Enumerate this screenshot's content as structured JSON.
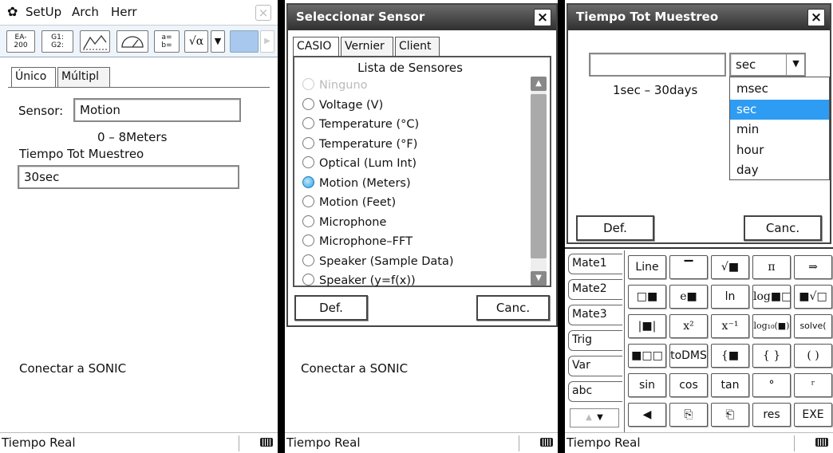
{
  "screen1": {
    "menu": {
      "setup": "SetUp",
      "arch": "Arch",
      "herr": "Herr"
    },
    "toolbar": {
      "b1a": "EA-",
      "b1b": "200",
      "b2a": "G1:",
      "b2b": "G2:",
      "b5a": "a=",
      "b5b": "b=",
      "b6": "√α",
      "b7": "▼"
    },
    "tabs": {
      "unico": "Único",
      "multiple": "Múltipl"
    },
    "sensor_label": "Sensor:",
    "sensor_value": "Motion",
    "range": "0 – 8Meters",
    "total_time_label": "Tiempo Tot Muestreo",
    "total_time_value": "30sec",
    "connect": "Conectar a SONIC",
    "status": "Tiempo Real"
  },
  "screen2": {
    "title": "Seleccionar Sensor",
    "tabs": {
      "casio": "CASIO",
      "vernier": "Vernier",
      "client": "Client"
    },
    "list_title": "Lista de Sensores",
    "options": [
      {
        "label": "Ninguno",
        "state": "disabled"
      },
      {
        "label": "Voltage (V)",
        "state": "off"
      },
      {
        "label": "Temperature (°C)",
        "state": "off"
      },
      {
        "label": "Temperature (°F)",
        "state": "off"
      },
      {
        "label": "Optical (Lum Int)",
        "state": "off"
      },
      {
        "label": "Motion (Meters)",
        "state": "on"
      },
      {
        "label": "Motion (Feet)",
        "state": "off"
      },
      {
        "label": "Microphone",
        "state": "off"
      },
      {
        "label": "Microphone–FFT",
        "state": "off"
      },
      {
        "label": "Speaker (Sample Data)",
        "state": "off"
      },
      {
        "label": "Speaker (y=f(x))",
        "state": "off"
      }
    ],
    "def": "Def.",
    "canc": "Canc.",
    "connect": "Conectar a SONIC",
    "status": "Tiempo Real"
  },
  "screen3": {
    "title": "Tiempo Tot Muestreo",
    "unit_selected": "sec",
    "range": "1sec – 30days",
    "units": [
      "msec",
      "sec",
      "min",
      "hour",
      "day"
    ],
    "selected_unit": "sec",
    "def": "Def.",
    "canc": "Canc.",
    "keyboard_tabs": [
      "Mate1",
      "Mate2",
      "Mate3",
      "Trig",
      "Var",
      "abc"
    ],
    "keys": [
      [
        "Line",
        "▔",
        "√■",
        "π",
        "⇒"
      ],
      [
        "□■",
        "e■",
        "ln",
        "log■□",
        "■√□"
      ],
      [
        "|■|",
        "x²",
        "x⁻¹",
        "log₁₀(■)",
        "solve("
      ],
      [
        "■□□",
        "toDMS",
        "{■",
        "{ }",
        "( )"
      ],
      [
        "sin",
        "cos",
        "tan",
        "°",
        "ʳ"
      ],
      [
        "◀",
        "⎘",
        "⎗",
        "res",
        "EXE"
      ]
    ],
    "status": "Tiempo Real"
  }
}
